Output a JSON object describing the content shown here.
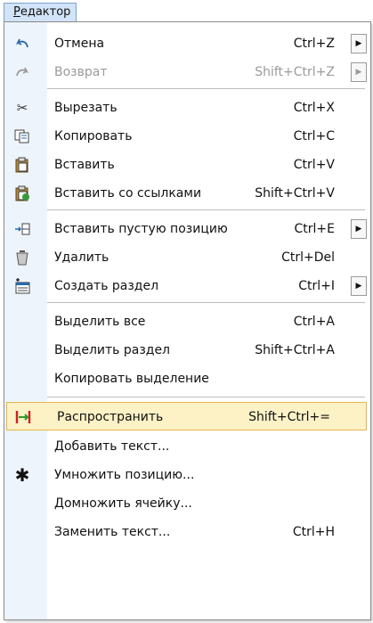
{
  "menubar": {
    "editor_label": "Редактор"
  },
  "menu": {
    "undo": {
      "label": "Отмена",
      "shortcut": "Ctrl+Z",
      "icon": "undo-icon"
    },
    "redo": {
      "label": "Возврат",
      "shortcut": "Shift+Ctrl+Z",
      "icon": "redo-icon",
      "disabled": true
    },
    "cut": {
      "label": "Вырезать",
      "shortcut": "Ctrl+X",
      "icon": "scissors-icon"
    },
    "copy": {
      "label": "Копировать",
      "shortcut": "Ctrl+C",
      "icon": "copy-icon"
    },
    "paste": {
      "label": "Вставить",
      "shortcut": "Ctrl+V",
      "icon": "clipboard-icon"
    },
    "paste_links": {
      "label": "Вставить со ссылками",
      "shortcut": "Shift+Ctrl+V",
      "icon": "clipboard-link-icon"
    },
    "insert_empty": {
      "label": "Вставить пустую позицию",
      "shortcut": "Ctrl+E",
      "icon": "insert-row-icon"
    },
    "delete": {
      "label": "Удалить",
      "shortcut": "Ctrl+Del",
      "icon": "trash-icon"
    },
    "create_section": {
      "label": "Создать раздел",
      "shortcut": "Ctrl+I",
      "icon": "new-section-icon"
    },
    "select_all": {
      "label": "Выделить все",
      "shortcut": "Ctrl+A"
    },
    "select_section": {
      "label": "Выделить раздел",
      "shortcut": "Shift+Ctrl+A"
    },
    "copy_selection": {
      "label": "Копировать выделение"
    },
    "spread": {
      "label": "Распространить",
      "shortcut": "Shift+Ctrl+=",
      "icon": "spread-icon",
      "highlighted": true
    },
    "add_text": {
      "label": "Добавить текст..."
    },
    "multiply": {
      "label": "Умножить позицию...",
      "icon": "asterisk-icon"
    },
    "multiply_cell": {
      "label": "Домножить ячейку..."
    },
    "replace_text": {
      "label": "Заменить текст...",
      "shortcut": "Ctrl+H"
    }
  },
  "colors": {
    "highlight_bg": "#fdf1c6",
    "highlight_border": "#e6b54e",
    "gutter": "#eef4fb"
  }
}
